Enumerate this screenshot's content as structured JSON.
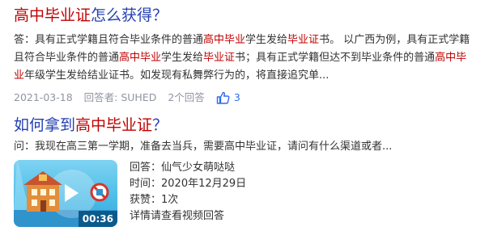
{
  "result1": {
    "title": {
      "pre": "高中毕业证",
      "post": "怎么获得？"
    },
    "answer": [
      {
        "t": "答：具有正式学籍且符合毕业条件的普通",
        "hl": false
      },
      {
        "t": "高中毕业",
        "hl": true
      },
      {
        "t": "学生发给",
        "hl": false
      },
      {
        "t": "毕业证",
        "hl": true
      },
      {
        "t": "书。 以广西为例，具有正式学籍且符合毕业条件的普通",
        "hl": false
      },
      {
        "t": "高中毕业",
        "hl": true
      },
      {
        "t": "学生发给",
        "hl": false
      },
      {
        "t": "毕业证",
        "hl": true
      },
      {
        "t": "书；具有正式学籍但达不到毕业条件的普通",
        "hl": false
      },
      {
        "t": "高中毕业",
        "hl": true
      },
      {
        "t": "年级学生发给结业证书。如发现有私舞弊行为的，将直接追究单...",
        "hl": false
      }
    ],
    "meta": {
      "date": "2021-03-18",
      "responder": "回答者: SUHED",
      "answers": "2个回答",
      "likes": "3"
    }
  },
  "result2": {
    "title": {
      "pre": "如何拿到",
      "hl": "高中毕业证",
      "post": "？"
    },
    "question": "问：我现在高三第一学期，准备去当兵，需要高中毕业证，请问有什么渠道或者...",
    "video": {
      "duration": "00:36",
      "responder": "回答：仙气少女萌哒哒",
      "time": "时间：2020年12月29日",
      "praise": "获赞：1次",
      "detail": "详情请查看视频回答"
    }
  },
  "colors": {
    "link": "#2440b3",
    "highlight": "#c00000",
    "meta": "#9195a3",
    "like": "#2e6bf0"
  }
}
